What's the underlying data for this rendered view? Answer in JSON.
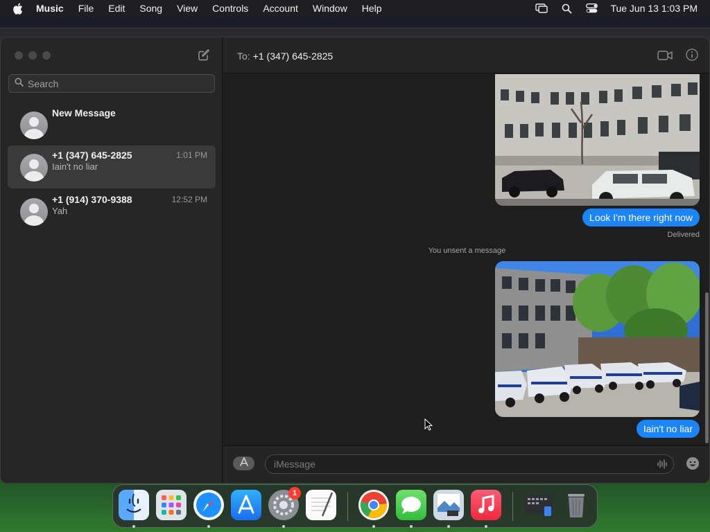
{
  "menubar": {
    "app_name": "Music",
    "items": [
      "File",
      "Edit",
      "Song",
      "View",
      "Controls",
      "Account",
      "Window",
      "Help"
    ],
    "clock": "Tue Jun 13  1:03 PM"
  },
  "sidebar": {
    "search_placeholder": "Search",
    "conversations": [
      {
        "name": "New Message",
        "preview": "",
        "time": ""
      },
      {
        "name": "+1 (347) 645-2825",
        "preview": "Iain't no liar",
        "time": "1:01 PM",
        "selected": true
      },
      {
        "name": "+1 (914) 370-9388",
        "preview": "Yah",
        "time": "12:52 PM"
      }
    ]
  },
  "header": {
    "to_label": "To:",
    "to_value": "+1 (347) 645-2825"
  },
  "transcript": {
    "bubble1": "Look I'm there right now",
    "delivered": "Delivered",
    "unsent_notice": "You unsent a message",
    "bubble2": "Iain't no liar"
  },
  "composer": {
    "placeholder": "iMessage"
  },
  "dock": {
    "apps": [
      "Finder",
      "Launchpad",
      "Safari",
      "App Store",
      "System Settings",
      "TextEdit",
      "Google Chrome",
      "Messages",
      "Preview",
      "Music",
      "Screenshot",
      "Trash"
    ],
    "settings_badge": "1"
  },
  "colors": {
    "bubble": "#1c85f5",
    "sidebar": "#262626",
    "selected_row": "#3a3a3a",
    "badge": "#ff3b30"
  }
}
